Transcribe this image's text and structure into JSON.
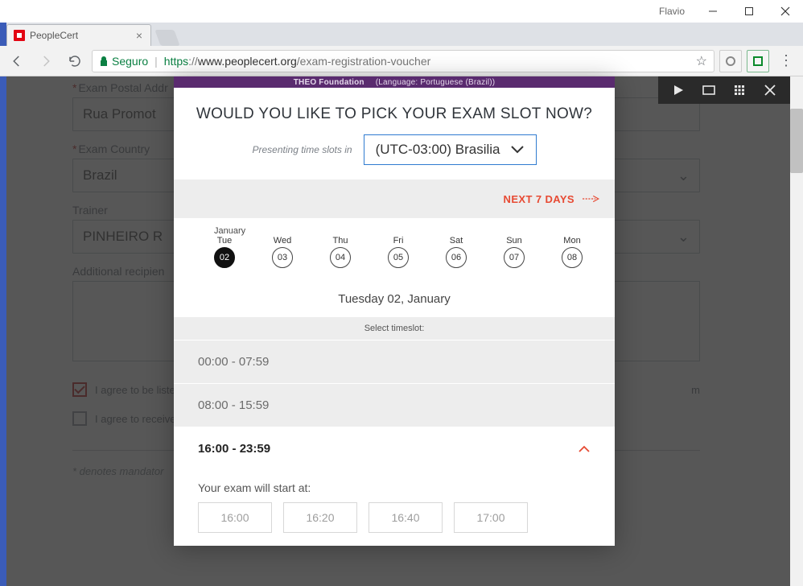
{
  "window": {
    "profile": "Flavio"
  },
  "tab": {
    "title": "PeopleCert"
  },
  "addressbar": {
    "secure_label": "Seguro",
    "protocol": "https",
    "host": "www.peoplecert.org",
    "path": "/exam-registration-voucher"
  },
  "form": {
    "postal_label": "Exam Postal Addr",
    "postal_value": "Rua Promot",
    "country_label": "Exam Country",
    "country_value": "Brazil",
    "trainer_label": "Trainer",
    "trainer_value": "PINHEIRO R",
    "recipients_label": "Additional recipien",
    "agree_listed": "I agree to be liste",
    "agree_receive": "I agree to receive",
    "mandatory_note": "* denotes mandator",
    "truncated_right": "m"
  },
  "modal": {
    "bar_left": "THEO Foundation",
    "bar_right": "(Language: Portuguese (Brazil))",
    "question": "WOULD YOU LIKE TO PICK YOUR EXAM SLOT NOW?",
    "tz_label": "Presenting time slots in",
    "tz_value": "(UTC-03:00) Brasilia",
    "next_days": "NEXT 7 DAYS",
    "month": "January",
    "days": [
      {
        "dow": "Tue",
        "num": "02",
        "selected": true
      },
      {
        "dow": "Wed",
        "num": "03",
        "selected": false
      },
      {
        "dow": "Thu",
        "num": "04",
        "selected": false
      },
      {
        "dow": "Fri",
        "num": "05",
        "selected": false
      },
      {
        "dow": "Sat",
        "num": "06",
        "selected": false
      },
      {
        "dow": "Sun",
        "num": "07",
        "selected": false
      },
      {
        "dow": "Mon",
        "num": "08",
        "selected": false
      }
    ],
    "selected_day_label": "Tuesday 02, January",
    "select_prompt": "Select timeslot:",
    "range_early": "00:00 - 07:59",
    "range_mid": "08:00 - 15:59",
    "range_late": "16:00 - 23:59",
    "start_label": "Your exam will start at:",
    "slots": [
      "16:00",
      "16:20",
      "16:40",
      "17:00"
    ]
  }
}
